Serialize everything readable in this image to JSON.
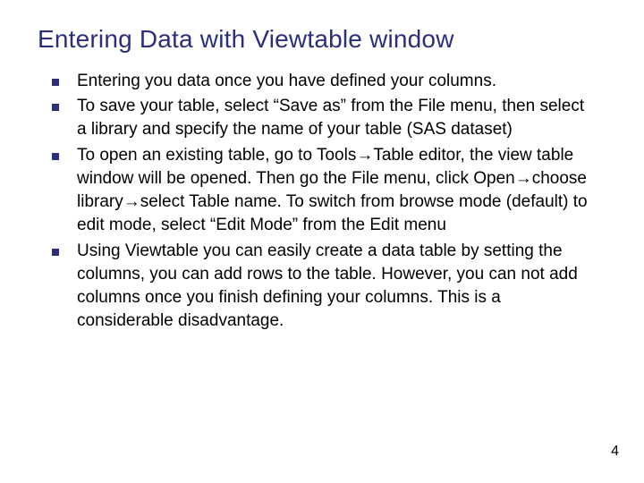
{
  "title": "Entering Data with Viewtable window",
  "bullets": [
    "Entering you data once you have defined your columns.",
    "To save your table, select “Save as” from the File menu, then select a library and specify the name of your table (SAS dataset)",
    "To open an existing table, go to Tools→Table editor, the view table window will be opened. Then go the File menu, click Open→choose library→select Table name. To switch from browse mode (default) to edit mode, select “Edit Mode” from the Edit menu",
    "Using Viewtable you can easily create a data table by setting the columns, you can add rows to the table. However, you can not add columns once you finish defining your columns. This is a considerable disadvantage."
  ],
  "page_number": "4"
}
